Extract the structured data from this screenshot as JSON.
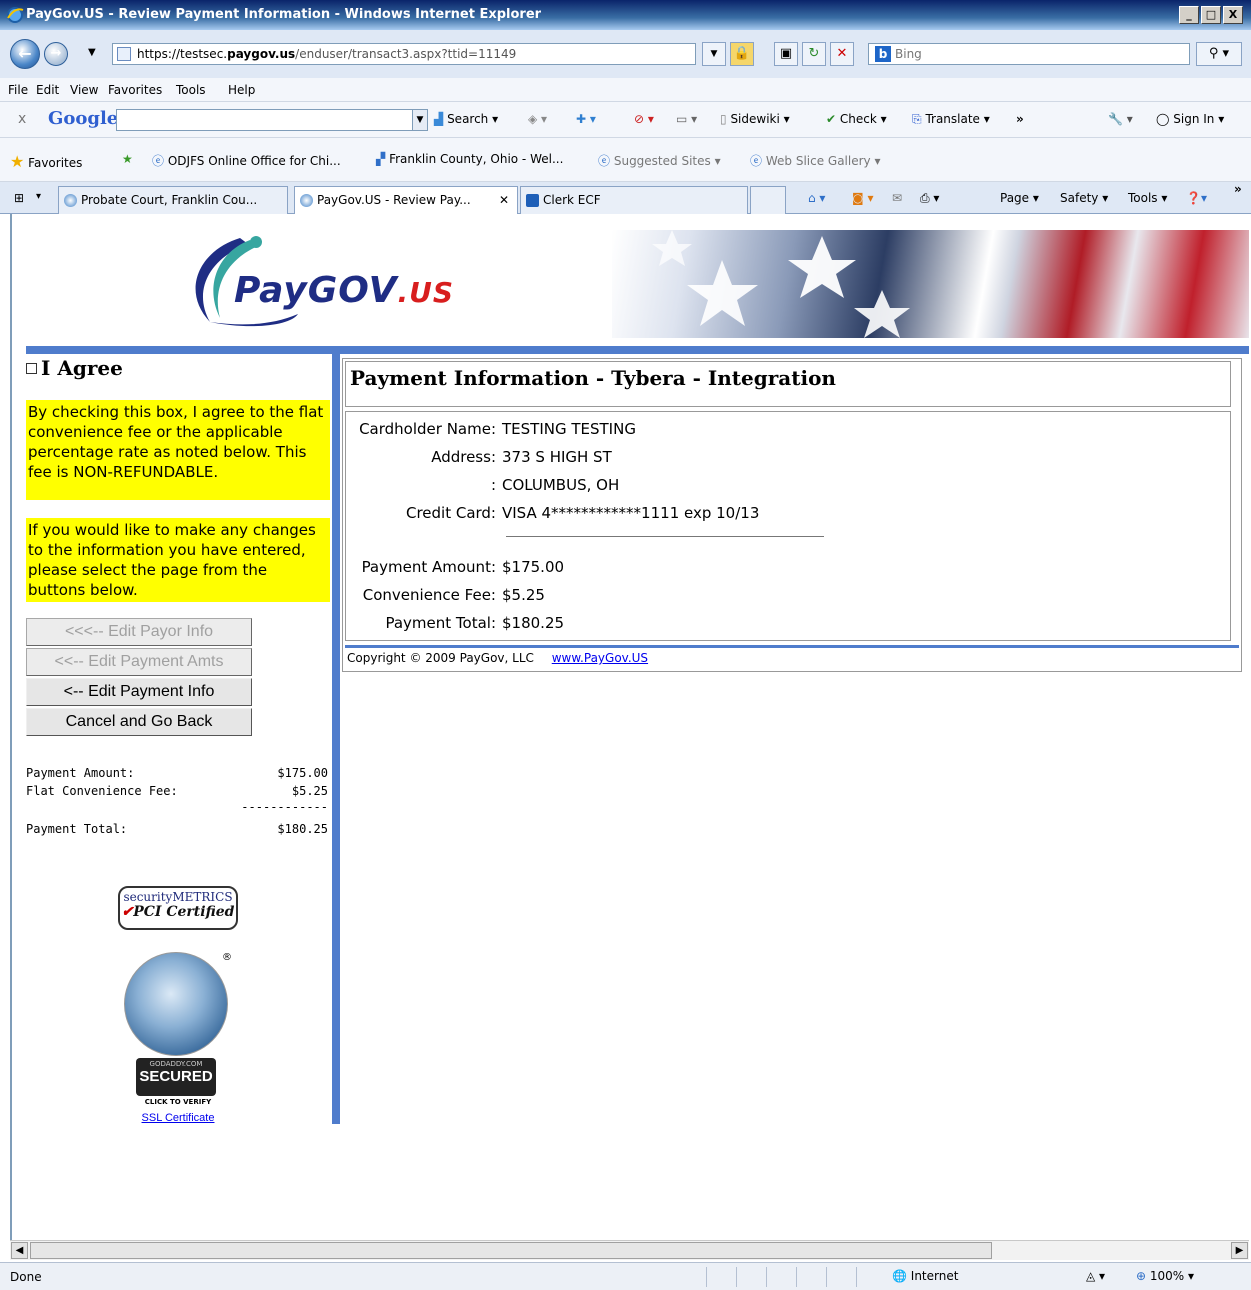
{
  "window": {
    "title": "PayGov.US - Review Payment Information - Windows Internet Explorer",
    "min_glyph": "_",
    "max_glyph": "□",
    "close_glyph": "X"
  },
  "address_bar": {
    "url_prefix": "https://testsec.",
    "url_domain": "paygov.us",
    "url_rest": "/enduser/transact3.aspx?ttid=11149",
    "search_placeholder": "Bing"
  },
  "menu": {
    "items": [
      "File",
      "Edit",
      "View",
      "Favorites",
      "Tools",
      "Help"
    ]
  },
  "google_toolbar": {
    "close": "x",
    "logo": "Google",
    "search": "Search",
    "sidewiki": "Sidewiki",
    "check": "Check",
    "translate": "Translate",
    "more": "»",
    "sign_in": "Sign In"
  },
  "favorites_bar": {
    "favorites": "Favorites",
    "items": [
      "ODJFS Online  Office for Chi...",
      "Franklin County, Ohio - Wel...",
      "Suggested Sites",
      "Web Slice Gallery"
    ]
  },
  "tabs": [
    {
      "label": "Probate Court, Franklin Cou..."
    },
    {
      "label": "PayGov.US - Review Pay..."
    },
    {
      "label": "Clerk ECF"
    }
  ],
  "command_bar": {
    "page": "Page",
    "safety": "Safety",
    "tools": "Tools"
  },
  "banner": {
    "logo_main": "PayGOV",
    "logo_suffix": ".US"
  },
  "sidebar": {
    "agree_label": "I Agree",
    "agree_checked": false,
    "notice_1": "By checking this box, I agree to the flat convenience fee or the applicable percentage rate as noted below. This fee is NON-REFUNDABLE.",
    "notice_2": "If you would like to make any changes to the information you have entered, please select the page from the buttons below.",
    "buttons": {
      "edit_payor": "<<<-- Edit Payor Info",
      "edit_amounts": "<<-- Edit Payment Amts",
      "edit_payment": "<-- Edit Payment Info",
      "cancel": "Cancel and Go Back"
    },
    "summary": {
      "payment_amount_label": "Payment Amount:",
      "payment_amount_value": "$175.00",
      "fee_label": "Flat Convenience Fee:",
      "fee_value": "$5.25",
      "rule": "------------",
      "total_label": "Payment Total:",
      "total_value": "$180.25"
    },
    "pci_badge": {
      "top": "securityMETRICS",
      "bottom": "PCI Certified"
    },
    "godaddy_badge": {
      "small": "GODADDY.COM",
      "big": "SECURED",
      "click": "CLICK TO VERIFY",
      "registered": "®"
    },
    "ssl_link": "SSL Certificate"
  },
  "main": {
    "title": "Payment Information - Tybera - Integration",
    "cardholder_label": "Cardholder Name:",
    "cardholder_value": "TESTING TESTING",
    "address_label": "Address:",
    "address_value": "373 S HIGH ST",
    "address2_label": ":",
    "address2_value": "COLUMBUS, OH",
    "card_label": "Credit Card:",
    "card_value": "VISA 4************1111 exp 10/13",
    "payment_amount_label": "Payment Amount:",
    "payment_amount_value": "$175.00",
    "fee_label": "Convenience Fee:",
    "fee_value": "$5.25",
    "total_label": "Payment Total:",
    "total_value": "$180.25",
    "copyright": "Copyright © 2009 PayGov, LLC",
    "copyright_link": "www.PayGov.US"
  },
  "status_bar": {
    "status": "Done",
    "zone": "Internet",
    "zoom": "100%"
  },
  "colors": {
    "accent_blue": "#4f7ccc",
    "notice_yellow": "#ffff00",
    "logo_blue": "#1f2d84",
    "logo_red": "#d81e1e"
  }
}
